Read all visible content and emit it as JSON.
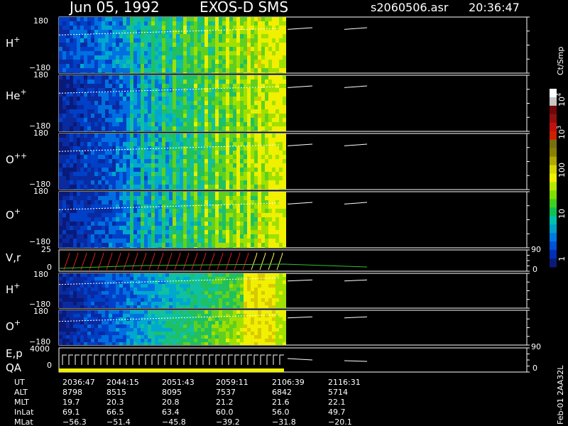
{
  "header": {
    "date": "Jun 05, 1992",
    "mission": "EXOS-D SMS",
    "file": "s2060506.asr",
    "time": "20:36:47"
  },
  "panels": [
    {
      "id": "h1",
      "label_base": "H",
      "label_sup": "+",
      "ymax": "180",
      "ymin": "−180"
    },
    {
      "id": "he1",
      "label_base": "He",
      "label_sup": "+",
      "ymax": "180",
      "ymin": "−180"
    },
    {
      "id": "o2",
      "label_base": "O",
      "label_sup": "++",
      "ymax": "180",
      "ymin": "−180"
    },
    {
      "id": "o1",
      "label_base": "O",
      "label_sup": "+",
      "ymax": "180",
      "ymin": "−180"
    },
    {
      "id": "vr",
      "label_base": "V,r",
      "label_sup": "",
      "ymax": "25",
      "ymin": "0",
      "rmax": "90",
      "rmin": "0"
    },
    {
      "id": "h2",
      "label_base": "H",
      "label_sup": "+",
      "ymax": "180",
      "ymin": "−180"
    },
    {
      "id": "o3",
      "label_base": "O",
      "label_sup": "+",
      "ymax": "180",
      "ymin": "−180"
    },
    {
      "id": "ep",
      "label_base": "E,p",
      "label_sup": "",
      "label2": "QA",
      "ymax": "4000",
      "ymin": "0",
      "rmax": "90",
      "rmin": "0"
    }
  ],
  "colorbar": {
    "unit": "Ct/Smp",
    "ticks": [
      "1",
      "10",
      "100"
    ],
    "ticks_pow": [
      {
        "base": "10",
        "exp": "3"
      },
      {
        "base": "10",
        "exp": "4"
      }
    ],
    "colors": [
      "#0a1a7a",
      "#0030b4",
      "#0050d8",
      "#0078e6",
      "#00a0c8",
      "#00c0b0",
      "#10c050",
      "#40d020",
      "#80e000",
      "#b8e800",
      "#f0f000",
      "#d8d800",
      "#b0a800",
      "#8a8000",
      "#787010",
      "#d02000",
      "#c01010",
      "#901010",
      "#700808",
      "#c8c8c8",
      "#ffffff"
    ]
  },
  "time_table": {
    "rows": [
      {
        "label": "UT",
        "values": [
          "2036:47",
          "2044:15",
          "2051:43",
          "2059:11",
          "2106:39",
          "2116:31"
        ]
      },
      {
        "label": "ALT",
        "values": [
          "8798",
          "8515",
          "8095",
          "7537",
          "6842",
          "5714"
        ]
      },
      {
        "label": "MLT",
        "values": [
          "19.7",
          "20.3",
          "20.8",
          "21.2",
          "21.6",
          "22.1"
        ]
      },
      {
        "label": "InLat",
        "values": [
          "69.1",
          "66.5",
          "63.4",
          "60.0",
          "56.0",
          "49.7"
        ]
      },
      {
        "label": "MLat",
        "values": [
          "−56.3",
          "−51.4",
          "−45.8",
          "−39.2",
          "−31.8",
          "−20.1"
        ]
      }
    ]
  },
  "footer": {
    "stamp": "Feb-01 2AA32L"
  },
  "chart_data": {
    "type": "heatmap",
    "title": "Jun 05, 1992   EXOS-D SMS",
    "xlabel": "UT",
    "x_ticks": [
      "2036:47",
      "2044:15",
      "2051:43",
      "2059:11",
      "2106:39",
      "2116:31"
    ],
    "panels": [
      "H+",
      "He+",
      "O++",
      "O+",
      "V,r",
      "H+",
      "O+",
      "E,p QA"
    ],
    "pitch_angle_range": [
      -180,
      180
    ],
    "v_range": [
      0,
      25
    ],
    "r_range": [
      0,
      90
    ],
    "e_range": [
      0,
      4000
    ],
    "colorbar_label": "Ct/Smp",
    "colorbar_ticks": [
      "1",
      "10",
      "100",
      "10^3",
      "10^4"
    ],
    "data_end_fraction": 0.5
  }
}
